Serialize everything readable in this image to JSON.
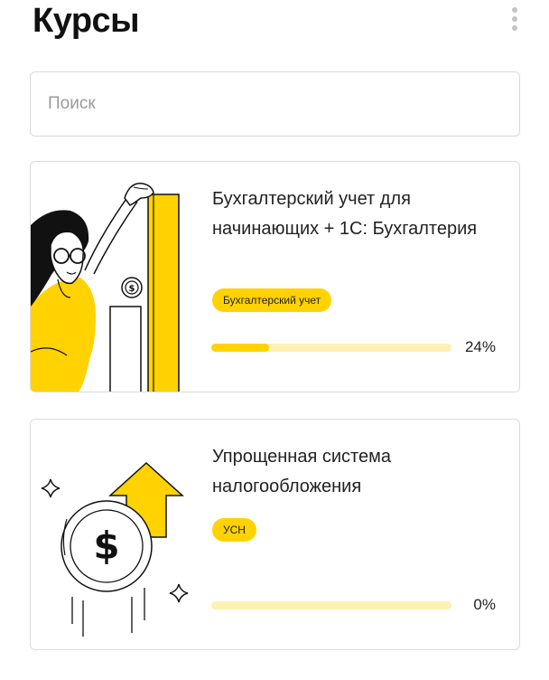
{
  "header": {
    "title": "Курсы"
  },
  "search": {
    "placeholder": "Поиск",
    "value": ""
  },
  "courses": [
    {
      "title": "Бухгалтерский учет для начинающих + 1С: Бухгалтерия",
      "tag": "Бухгалтерский учет",
      "progress": 0.24,
      "progress_label": "24%",
      "illustration": "woman-with-chart-illustration"
    },
    {
      "title": "Упрощенная система налогообложения",
      "tag": "УСН",
      "progress": 0.0,
      "progress_label": "0%",
      "illustration": "dollar-coin-arrow-illustration"
    }
  ],
  "colors": {
    "accent": "#ffd200",
    "track": "#fff0b3",
    "border": "#dcdcdc",
    "text": "#222222",
    "placeholder": "#9a9a9a"
  }
}
